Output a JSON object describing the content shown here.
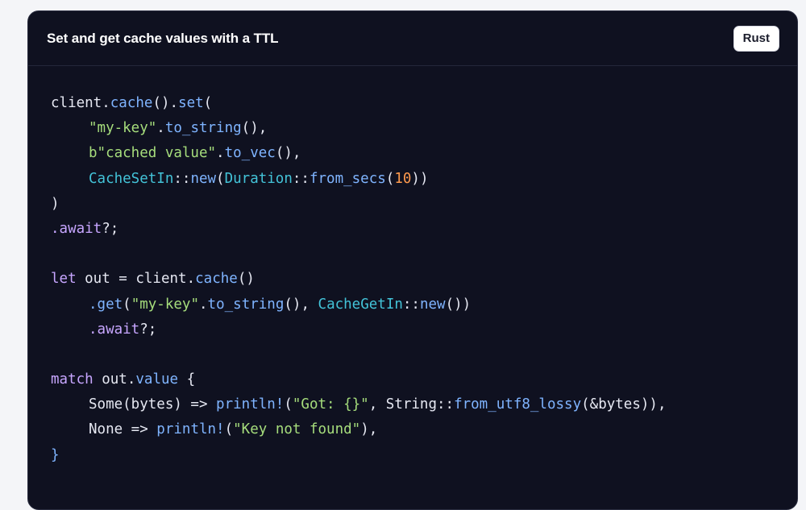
{
  "header": {
    "title": "Set and get cache values with a TTL",
    "language_label": "Rust"
  },
  "colors": {
    "background": "#0f1120",
    "function": "#7fb4ff",
    "string": "#a6dd7c",
    "type": "#43c3d8",
    "number": "#ff9a4d",
    "keyword": "#c7a6ff",
    "plain": "#e6e8f2"
  },
  "code": {
    "lines": [
      {
        "indent": 0,
        "tokens": [
          {
            "t": "client.",
            "k": "pl"
          },
          {
            "t": "cache",
            "k": "fn"
          },
          {
            "t": "().",
            "k": "pl"
          },
          {
            "t": "set",
            "k": "fn"
          },
          {
            "t": "(",
            "k": "pl"
          }
        ]
      },
      {
        "indent": 1,
        "tokens": [
          {
            "t": "\"my-key\"",
            "k": "str"
          },
          {
            "t": ".",
            "k": "pl"
          },
          {
            "t": "to_string",
            "k": "fn"
          },
          {
            "t": "(),",
            "k": "pl"
          }
        ]
      },
      {
        "indent": 1,
        "tokens": [
          {
            "t": "b\"cached value\"",
            "k": "str"
          },
          {
            "t": ".",
            "k": "pl"
          },
          {
            "t": "to_vec",
            "k": "fn"
          },
          {
            "t": "(),",
            "k": "pl"
          }
        ]
      },
      {
        "indent": 1,
        "tokens": [
          {
            "t": "CacheSetIn",
            "k": "type"
          },
          {
            "t": "::",
            "k": "pl"
          },
          {
            "t": "new",
            "k": "fn"
          },
          {
            "t": "(",
            "k": "pl"
          },
          {
            "t": "Duration",
            "k": "type"
          },
          {
            "t": "::",
            "k": "pl"
          },
          {
            "t": "from_secs",
            "k": "fn"
          },
          {
            "t": "(",
            "k": "pl"
          },
          {
            "t": "10",
            "k": "num"
          },
          {
            "t": "))",
            "k": "pl"
          }
        ]
      },
      {
        "indent": 0,
        "tokens": [
          {
            "t": ")",
            "k": "pl"
          }
        ]
      },
      {
        "indent": 0,
        "tokens": [
          {
            "t": ".await",
            "k": "kw"
          },
          {
            "t": "?;",
            "k": "pl"
          }
        ]
      },
      {
        "indent": 0,
        "tokens": []
      },
      {
        "indent": 0,
        "tokens": [
          {
            "t": "let",
            "k": "kw"
          },
          {
            "t": " out = client.",
            "k": "pl"
          },
          {
            "t": "cache",
            "k": "fn"
          },
          {
            "t": "()",
            "k": "pl"
          }
        ]
      },
      {
        "indent": 1,
        "tokens": [
          {
            "t": ".get",
            "k": "fn"
          },
          {
            "t": "(",
            "k": "pl"
          },
          {
            "t": "\"my-key\"",
            "k": "str"
          },
          {
            "t": ".",
            "k": "pl"
          },
          {
            "t": "to_string",
            "k": "fn"
          },
          {
            "t": "(), ",
            "k": "pl"
          },
          {
            "t": "CacheGetIn",
            "k": "type"
          },
          {
            "t": "::",
            "k": "pl"
          },
          {
            "t": "new",
            "k": "fn"
          },
          {
            "t": "())",
            "k": "pl"
          }
        ]
      },
      {
        "indent": 1,
        "tokens": [
          {
            "t": ".await",
            "k": "kw"
          },
          {
            "t": "?;",
            "k": "pl"
          }
        ]
      },
      {
        "indent": 0,
        "tokens": []
      },
      {
        "indent": 0,
        "tokens": [
          {
            "t": "match",
            "k": "kw"
          },
          {
            "t": " out.",
            "k": "pl"
          },
          {
            "t": "value",
            "k": "fn"
          },
          {
            "t": " {",
            "k": "pl"
          }
        ]
      },
      {
        "indent": 1,
        "tokens": [
          {
            "t": "Some(bytes) => ",
            "k": "pl"
          },
          {
            "t": "println!",
            "k": "fn"
          },
          {
            "t": "(",
            "k": "pl"
          },
          {
            "t": "\"Got: {}\"",
            "k": "str"
          },
          {
            "t": ", String::",
            "k": "pl"
          },
          {
            "t": "from_utf8_lossy",
            "k": "fn"
          },
          {
            "t": "(&bytes)),",
            "k": "pl"
          }
        ]
      },
      {
        "indent": 1,
        "tokens": [
          {
            "t": "None => ",
            "k": "pl"
          },
          {
            "t": "println!",
            "k": "fn"
          },
          {
            "t": "(",
            "k": "pl"
          },
          {
            "t": "\"Key not found\"",
            "k": "str"
          },
          {
            "t": "),",
            "k": "pl"
          }
        ]
      },
      {
        "indent": 0,
        "tokens": [
          {
            "t": "}",
            "k": "fn"
          }
        ]
      }
    ]
  }
}
